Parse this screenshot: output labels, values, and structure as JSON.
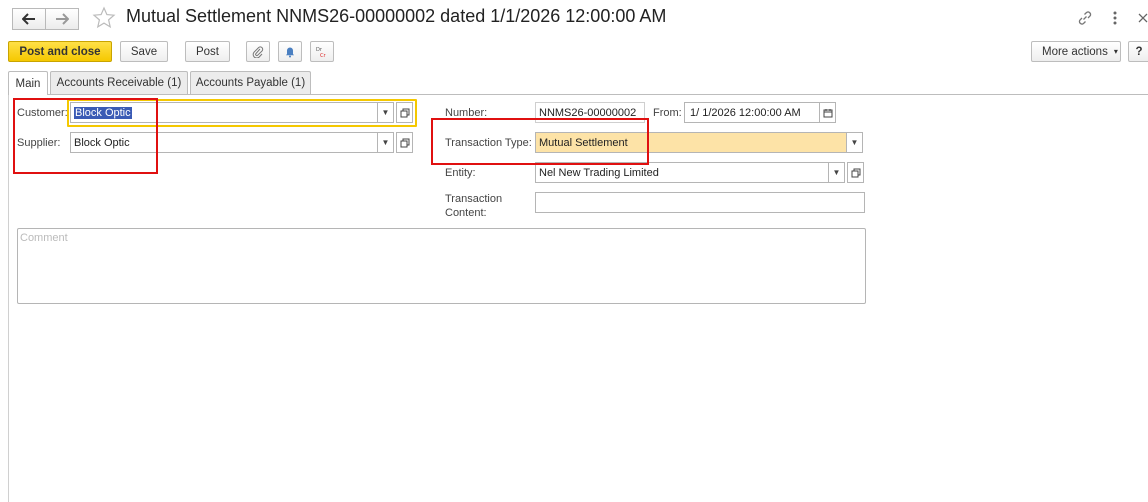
{
  "window": {
    "title": "Mutual Settlement NNMS26-00000002 dated 1/1/2026 12:00:00 AM"
  },
  "icons": {
    "back": "arrow-left-icon",
    "forward": "arrow-right-icon",
    "favorite": "star-icon",
    "link": "link-icon",
    "menu": "more-vertical-icon",
    "close": "close-icon"
  },
  "toolbar": {
    "post_and_close": "Post and close",
    "save": "Save",
    "post": "Post",
    "more_actions": "More actions",
    "help": "?"
  },
  "tabs": [
    {
      "label": "Main"
    },
    {
      "label": "Accounts Receivable (1)"
    },
    {
      "label": "Accounts Payable (1)"
    }
  ],
  "form": {
    "customer_label": "Customer:",
    "customer_value": "Block Optic",
    "supplier_label": "Supplier:",
    "supplier_value": "Block Optic",
    "number_label": "Number:",
    "number_value": "NNMS26-00000002",
    "from_label": "From:",
    "from_value": "1/ 1/2026 12:00:00 AM",
    "transaction_type_label": "Transaction Type:",
    "transaction_type_value": "Mutual Settlement",
    "entity_label": "Entity:",
    "entity_value": "Nel New Trading Limited",
    "transaction_content_label_1": "Transaction",
    "transaction_content_label_2": "Content:",
    "transaction_content_value": "",
    "comment_placeholder": "Comment"
  },
  "colors": {
    "primary_button": "#f5c800",
    "highlight_field": "#fde3a7",
    "annotation_red": "#e01010",
    "selection_blue": "#3b5bb5"
  }
}
